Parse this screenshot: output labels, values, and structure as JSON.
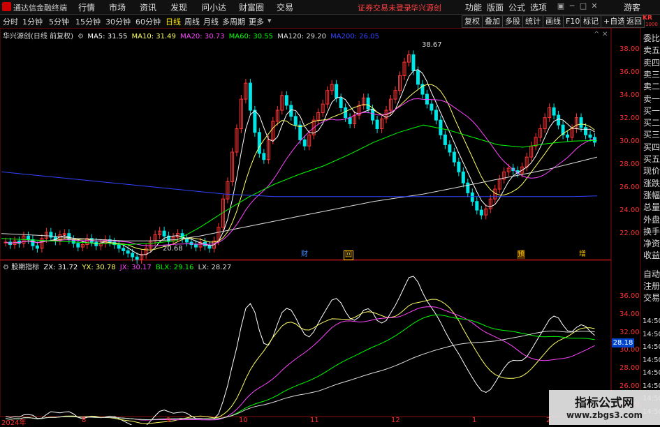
{
  "titlebar": {
    "app_name": "通达信金融终端",
    "menus": [
      "行情",
      "市场",
      "资讯",
      "发现",
      "问小达",
      "财富圈",
      "交易"
    ],
    "status": "证券交易未登录",
    "stock": "华兴源创",
    "right_menus": [
      "功能",
      "版面",
      "公式",
      "选项"
    ],
    "user": "游客"
  },
  "toolbar": {
    "periods": [
      "分时",
      "1分钟",
      "5分钟",
      "15分钟",
      "30分钟",
      "60分钟",
      "日线",
      "周线",
      "月线",
      "多周期",
      "更多"
    ],
    "active_period": "日线",
    "tools": [
      "复权",
      "叠加",
      "多股",
      "统计",
      "画线",
      "F10",
      "标记",
      "+自选",
      "返回"
    ]
  },
  "main_chart": {
    "title": "华兴源创(日线 前复权)",
    "ma": [
      {
        "label": "MA5: 31.55",
        "color": "#ffffff"
      },
      {
        "label": "MA10: 31.49",
        "color": "#ffff66"
      },
      {
        "label": "MA20: 30.73",
        "color": "#ff44ff"
      },
      {
        "label": "MA60: 30.55",
        "color": "#00ff00"
      },
      {
        "label": "MA120: 29.20",
        "color": "#dddddd"
      },
      {
        "label": "MA200: 26.05",
        "color": "#3344ff"
      }
    ],
    "high_label": "38.67",
    "low_label": "20.68",
    "y_ticks": [
      "38.00",
      "36.00",
      "34.00",
      "32.00",
      "30.00",
      "28.00",
      "26.00",
      "24.00",
      "22.00"
    ],
    "markers": [
      "财",
      "回",
      "预",
      "增"
    ]
  },
  "indicator": {
    "title": "股期指标",
    "values": [
      {
        "label": "ZX: 31.72",
        "color": "#ffffff"
      },
      {
        "label": "YX: 30.78",
        "color": "#ffff66"
      },
      {
        "label": "JX: 30.17",
        "color": "#ff44ff"
      },
      {
        "label": "BLX: 29.16",
        "color": "#00ff00"
      },
      {
        "label": "LX: 28.27",
        "color": "#dddddd"
      }
    ],
    "y_ticks": [
      "36.00",
      "34.00",
      "32.00",
      "30.00",
      "28.00",
      "26.00",
      "24.00"
    ],
    "current_value": "28.18"
  },
  "xaxis": {
    "labels": [
      "2024年",
      "8",
      "9",
      "10",
      "11",
      "12",
      "1",
      "2"
    ]
  },
  "rpanel": {
    "logo": "KR",
    "code": "1000",
    "items": [
      "委比",
      "卖五",
      "卖四",
      "卖三",
      "卖二",
      "卖一",
      "买一",
      "买二",
      "买三",
      "买四",
      "买五",
      "现价",
      "涨跌",
      "涨幅",
      "总量",
      "外盘",
      "换手",
      "净资",
      "收益"
    ],
    "lower_items": [
      "自动",
      "注册",
      "交易"
    ],
    "times": [
      "14:50",
      "14:50",
      "14:50",
      "14:50",
      "14:50",
      "14:50",
      "14:50",
      "14:50"
    ]
  },
  "watermark": {
    "line1": "指标公式网",
    "line2": "www.zbgs3.com"
  },
  "chart_data": {
    "type": "line",
    "candles": {
      "description_ref": "daily candles approximated",
      "values": [
        22.3,
        22.1,
        22.4,
        22.2,
        22.8,
        22.5,
        22.0,
        21.8,
        22.6,
        23.1,
        22.7,
        22.4,
        22.9,
        23.0,
        22.5,
        22.2,
        21.9,
        22.1,
        22.6,
        22.3,
        22.0,
        22.2,
        22.5,
        22.3,
        22.1,
        21.8,
        21.6,
        21.4,
        21.1,
        20.9,
        21.3,
        21.8,
        22.4,
        22.9,
        23.2,
        22.8,
        22.4,
        22.7,
        23.0,
        22.6,
        22.3,
        22.1,
        21.9,
        22.3,
        22.0,
        21.8,
        22.4,
        23.5,
        25.8,
        27.2,
        29.6,
        31.5,
        33.9,
        35.2,
        33.0,
        31.2,
        29.5,
        29.0,
        30.6,
        32.1,
        33.0,
        34.2,
        33.4,
        32.5,
        31.8,
        30.6,
        30.1,
        31.0,
        32.2,
        32.8,
        33.5,
        34.6,
        35.1,
        34.0,
        33.2,
        32.4,
        31.9,
        32.6,
        33.4,
        34.0,
        33.1,
        32.2,
        31.5,
        32.3,
        33.0,
        33.9,
        34.6,
        35.8,
        36.9,
        37.5,
        36.2,
        35.1,
        34.3,
        33.5,
        33.0,
        32.2,
        31.0,
        30.2,
        29.6,
        28.8,
        28.0,
        27.1,
        26.3,
        25.6,
        24.9,
        24.5,
        25.0,
        25.8,
        26.6,
        27.4,
        28.0,
        28.3,
        28.1,
        27.9,
        28.4,
        29.2,
        30.1,
        30.8,
        31.5,
        32.4,
        33.2,
        32.6,
        31.8,
        31.0,
        30.8,
        31.5,
        32.4,
        31.6,
        31.0,
        30.8,
        30.4
      ]
    },
    "ma_series": [
      {
        "name": "MA5",
        "color": "#ffffff"
      },
      {
        "name": "MA10",
        "color": "#ffff66"
      },
      {
        "name": "MA20",
        "color": "#ff44ff"
      },
      {
        "name": "MA60",
        "color": "#00ff00"
      },
      {
        "name": "MA120",
        "color": "#dddddd"
      },
      {
        "name": "MA200",
        "color": "#3344ff"
      }
    ],
    "ma200_values": [
      28.0,
      27.8,
      27.6,
      27.4,
      27.2,
      27.0,
      26.8,
      26.6,
      26.4,
      26.2,
      26.1,
      26.0,
      26.0,
      26.0,
      26.0,
      26.0,
      26.0,
      26.0,
      26.0,
      26.0,
      26.0,
      26.0,
      26.0,
      26.0,
      26.05
    ],
    "ma120_values": [
      23.0,
      22.9,
      22.8,
      22.6,
      22.5,
      22.4,
      22.4,
      22.5,
      22.8,
      23.2,
      23.6,
      24.0,
      24.4,
      24.8,
      25.2,
      25.6,
      25.9,
      26.2,
      26.6,
      27.0,
      27.4,
      27.8,
      28.2,
      28.7,
      29.2
    ],
    "ma60_values": [
      22.6,
      22.5,
      22.4,
      22.3,
      22.2,
      22.1,
      22.2,
      22.4,
      23.5,
      24.8,
      26.0,
      27.0,
      27.8,
      28.5,
      29.4,
      30.4,
      31.2,
      31.8,
      31.4,
      30.8,
      30.2,
      30.0,
      30.3,
      30.5,
      30.55
    ],
    "ylim": [
      21.0,
      39.0
    ],
    "indicator_ylim": [
      23.0,
      37.5
    ]
  }
}
